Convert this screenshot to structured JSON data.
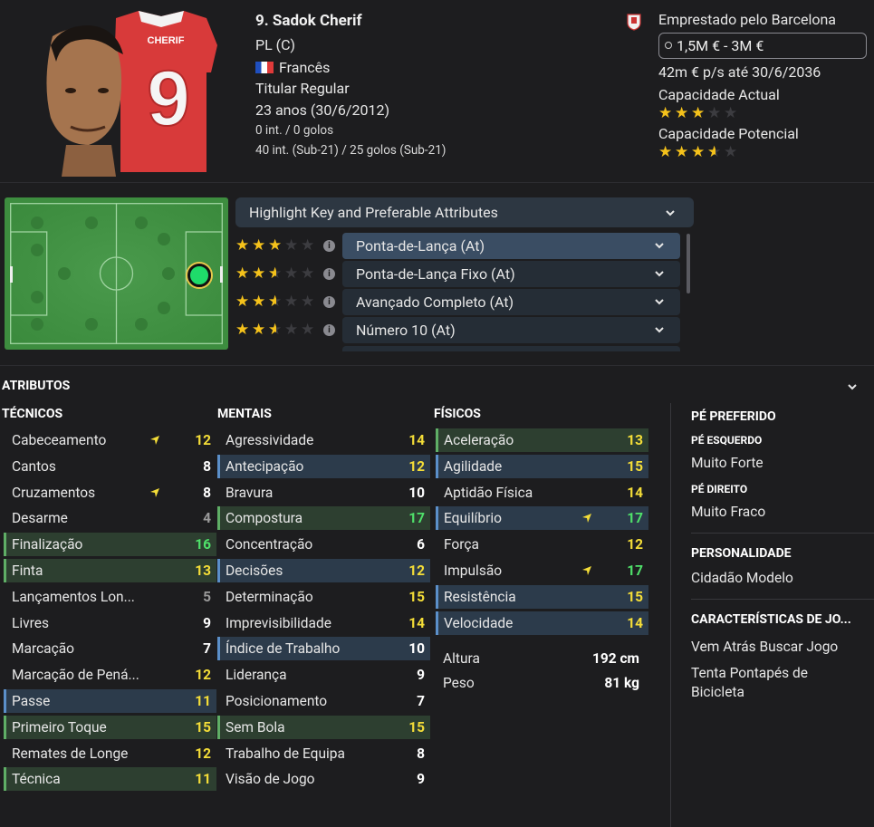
{
  "player": {
    "name": "9. Sadok Cherif",
    "position": "PL (C)",
    "nationality": "Francês",
    "status": "Titular Regular",
    "age": "23 anos (30/6/2012)",
    "caps": "0 int. / 0 golos",
    "u21_caps": "40 int. (Sub-21) / 25 golos (Sub-21)",
    "shirt_name": "CHERIF",
    "shirt_number": "9"
  },
  "contract": {
    "loan": "Emprestado pelo Barcelona",
    "value_range": "1,5M € - 3M €",
    "wage": "42m € p/s até 30/6/2036",
    "current_ability_label": "Capacidade Actual",
    "current_ability_stars": 3,
    "potential_ability_label": "Capacidade Potencial",
    "potential_ability_stars": 3.5
  },
  "roles": {
    "header": "Highlight Key and Preferable Attributes",
    "items": [
      {
        "label": "Ponta-de-Lança (At)",
        "stars": 3,
        "selected": true
      },
      {
        "label": "Ponta-de-Lança Fixo (At)",
        "stars": 2.5,
        "selected": false
      },
      {
        "label": "Avançado Completo (At)",
        "stars": 2.5,
        "selected": false
      },
      {
        "label": "Número 10 (At)",
        "stars": 2.5,
        "selected": false
      }
    ]
  },
  "attributes": {
    "title": "ATRIBUTOS",
    "technical_title": "TÉCNICOS",
    "mental_title": "MENTAIS",
    "physical_title": "FÍSICOS",
    "technical": [
      {
        "name": "Cabeceamento",
        "value": "12",
        "color": "y",
        "hl": "",
        "arrow": true
      },
      {
        "name": "Cantos",
        "value": "8",
        "color": "w",
        "hl": "",
        "arrow": false
      },
      {
        "name": "Cruzamentos",
        "value": "8",
        "color": "w",
        "hl": "",
        "arrow": true
      },
      {
        "name": "Desarme",
        "value": "4",
        "color": "gr",
        "hl": "",
        "arrow": false
      },
      {
        "name": "Finalização",
        "value": "16",
        "color": "g",
        "hl": "g",
        "arrow": false
      },
      {
        "name": "Finta",
        "value": "13",
        "color": "y",
        "hl": "g",
        "arrow": false
      },
      {
        "name": "Lançamentos Lon...",
        "value": "5",
        "color": "gr",
        "hl": "",
        "arrow": false
      },
      {
        "name": "Livres",
        "value": "9",
        "color": "w",
        "hl": "",
        "arrow": false
      },
      {
        "name": "Marcação",
        "value": "7",
        "color": "w",
        "hl": "",
        "arrow": false
      },
      {
        "name": "Marcação de Pená...",
        "value": "12",
        "color": "y",
        "hl": "",
        "arrow": false
      },
      {
        "name": "Passe",
        "value": "11",
        "color": "y",
        "hl": "b",
        "arrow": false
      },
      {
        "name": "Primeiro Toque",
        "value": "15",
        "color": "y",
        "hl": "g",
        "arrow": false
      },
      {
        "name": "Remates de Longe",
        "value": "12",
        "color": "y",
        "hl": "",
        "arrow": false
      },
      {
        "name": "Técnica",
        "value": "11",
        "color": "y",
        "hl": "g",
        "arrow": false
      }
    ],
    "mental": [
      {
        "name": "Agressividade",
        "value": "14",
        "color": "y",
        "hl": "",
        "arrow": false
      },
      {
        "name": "Antecipação",
        "value": "12",
        "color": "y",
        "hl": "b",
        "arrow": false
      },
      {
        "name": "Bravura",
        "value": "10",
        "color": "w",
        "hl": "",
        "arrow": false
      },
      {
        "name": "Compostura",
        "value": "17",
        "color": "g",
        "hl": "g",
        "arrow": false
      },
      {
        "name": "Concentração",
        "value": "6",
        "color": "w",
        "hl": "",
        "arrow": false
      },
      {
        "name": "Decisões",
        "value": "12",
        "color": "y",
        "hl": "b",
        "arrow": false
      },
      {
        "name": "Determinação",
        "value": "15",
        "color": "y",
        "hl": "",
        "arrow": false
      },
      {
        "name": "Imprevisibilidade",
        "value": "14",
        "color": "y",
        "hl": "",
        "arrow": false
      },
      {
        "name": "Índice de Trabalho",
        "value": "10",
        "color": "w",
        "hl": "b",
        "arrow": false
      },
      {
        "name": "Liderança",
        "value": "9",
        "color": "w",
        "hl": "",
        "arrow": false
      },
      {
        "name": "Posicionamento",
        "value": "7",
        "color": "w",
        "hl": "",
        "arrow": false
      },
      {
        "name": "Sem Bola",
        "value": "15",
        "color": "y",
        "hl": "g",
        "arrow": false
      },
      {
        "name": "Trabalho de Equipa",
        "value": "8",
        "color": "w",
        "hl": "",
        "arrow": false
      },
      {
        "name": "Visão de Jogo",
        "value": "9",
        "color": "w",
        "hl": "",
        "arrow": false
      }
    ],
    "physical": [
      {
        "name": "Aceleração",
        "value": "13",
        "color": "y",
        "hl": "g",
        "arrow": false
      },
      {
        "name": "Agilidade",
        "value": "15",
        "color": "y",
        "hl": "b",
        "arrow": false
      },
      {
        "name": "Aptidão Física",
        "value": "14",
        "color": "y",
        "hl": "",
        "arrow": false
      },
      {
        "name": "Equilíbrio",
        "value": "17",
        "color": "g",
        "hl": "b",
        "arrow": true
      },
      {
        "name": "Força",
        "value": "12",
        "color": "y",
        "hl": "",
        "arrow": false
      },
      {
        "name": "Impulsão",
        "value": "17",
        "color": "g",
        "hl": "",
        "arrow": true
      },
      {
        "name": "Resistência",
        "value": "15",
        "color": "y",
        "hl": "b",
        "arrow": false
      },
      {
        "name": "Velocidade",
        "value": "14",
        "color": "y",
        "hl": "b",
        "arrow": false
      }
    ],
    "height_label": "Altura",
    "height": "192 cm",
    "weight_label": "Peso",
    "weight": "81 kg"
  },
  "side": {
    "preferred_foot_title": "PÉ PREFERIDO",
    "left_foot_label": "PÉ ESQUERDO",
    "left_foot_value": "Muito Forte",
    "right_foot_label": "PÉ DIREITO",
    "right_foot_value": "Muito Fraco",
    "personality_title": "PERSONALIDADE",
    "personality_value": "Cidadão Modelo",
    "traits_title": "CARACTERÍSTICAS DE JO...",
    "traits": [
      "Vem Atrás Buscar Jogo",
      "Tenta Pontapés de Bicicleta"
    ]
  },
  "colors": {
    "yellow": "#f4dd38",
    "green": "#4fe06a",
    "white": "#ffffff",
    "grey": "#9a9a9a",
    "star": "#f5c21b",
    "highlight_blue": "#2c3b4b",
    "highlight_green": "#2d3f30"
  }
}
